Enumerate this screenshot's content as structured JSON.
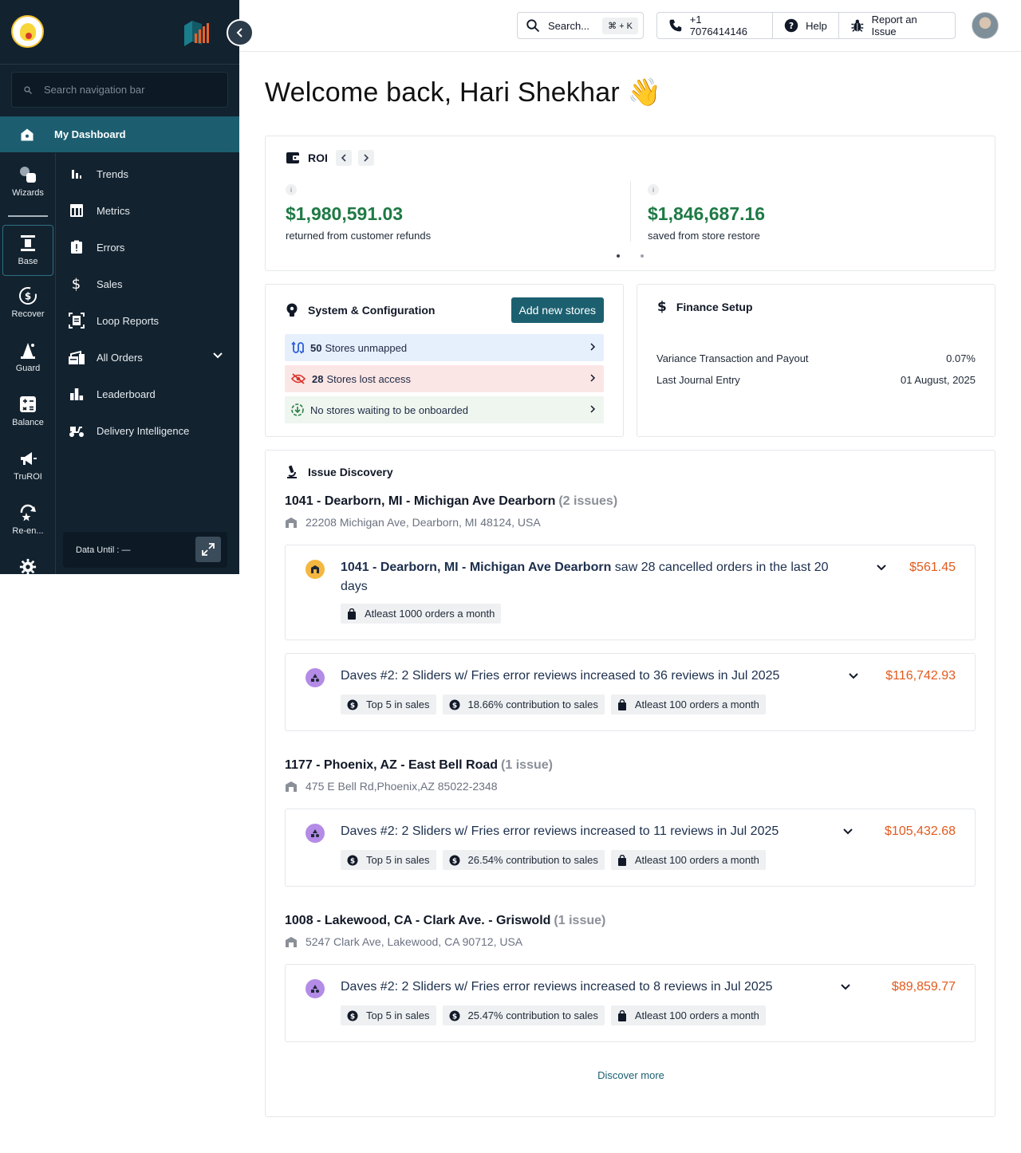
{
  "sidebar": {
    "search_placeholder": "Search navigation bar",
    "dashboard_label": "My Dashboard",
    "rail": [
      {
        "label": "Wizards"
      },
      {
        "label": "Base"
      },
      {
        "label": "Recover"
      },
      {
        "label": "Guard"
      },
      {
        "label": "Balance"
      },
      {
        "label": "TruROI"
      },
      {
        "label": "Re-en..."
      }
    ],
    "subnav": [
      {
        "label": "Trends"
      },
      {
        "label": "Metrics"
      },
      {
        "label": "Errors"
      },
      {
        "label": "Sales"
      },
      {
        "label": "Loop Reports"
      },
      {
        "label": "All Orders"
      },
      {
        "label": "Leaderboard"
      },
      {
        "label": "Delivery Intelligence"
      }
    ],
    "data_until": "Data Until : —"
  },
  "topbar": {
    "search_label": "Search...",
    "shortcut": "⌘ + K",
    "phone": "+1 7076414146",
    "help": "Help",
    "report": "Report an Issue"
  },
  "welcome": "Welcome back, Hari Shekhar 👋",
  "roi": {
    "title": "ROI",
    "info": "i",
    "items": [
      {
        "value": "$1,980,591.03",
        "caption": "returned from customer refunds"
      },
      {
        "value": "$1,846,687.16",
        "caption": "saved from store restore"
      }
    ]
  },
  "system": {
    "title": "System & Configuration",
    "add_button": "Add new stores",
    "rows": [
      {
        "count": "50",
        "text": "Stores unmapped"
      },
      {
        "count": "28",
        "text": "Stores lost access"
      },
      {
        "text": "No stores waiting to be onboarded"
      }
    ]
  },
  "finance": {
    "title": "Finance Setup",
    "rows": [
      {
        "label": "Variance Transaction and Payout",
        "value": "0.07%"
      },
      {
        "label": "Last Journal Entry",
        "value": "01 August, 2025"
      }
    ]
  },
  "issues": {
    "title": "Issue Discovery",
    "stores": [
      {
        "name": "1041 - Dearborn, MI - Michigan Ave Dearborn",
        "count": "(2 issues)",
        "address": "22208 Michigan Ave, Dearborn, MI 48124, USA",
        "items": [
          {
            "bold": "1041 - Dearborn, MI - Michigan Ave Dearborn",
            "text": " saw 28 cancelled orders in the last 20 days",
            "amount": "$561.45",
            "chips": [
              {
                "icon": "bag-icon",
                "label": "Atleast 1000 orders a month"
              }
            ]
          },
          {
            "text": "Daves #2: 2 Sliders w/ Fries error reviews increased to 36 reviews in Jul 2025",
            "amount": "$116,742.93",
            "chips": [
              {
                "icon": "dollar-icon",
                "label": "Top 5 in sales"
              },
              {
                "icon": "dollar-icon",
                "label": "18.66% contribution to sales"
              },
              {
                "icon": "bag-icon",
                "label": "Atleast 100 orders a month"
              }
            ]
          }
        ]
      },
      {
        "name": "1177 - Phoenix, AZ - East Bell Road",
        "count": "(1 issue)",
        "address": "475 E Bell Rd,Phoenix,AZ 85022-2348",
        "items": [
          {
            "text": "Daves #2: 2 Sliders w/ Fries error reviews increased to 11 reviews in Jul 2025",
            "amount": "$105,432.68",
            "chips": [
              {
                "icon": "dollar-icon",
                "label": "Top 5 in sales"
              },
              {
                "icon": "dollar-icon",
                "label": "26.54% contribution to sales"
              },
              {
                "icon": "bag-icon",
                "label": "Atleast 100 orders a month"
              }
            ]
          }
        ]
      },
      {
        "name": "1008 - Lakewood, CA - Clark Ave. - Griswold",
        "count": "(1 issue)",
        "address": "5247 Clark Ave, Lakewood, CA 90712, USA",
        "items": [
          {
            "text": "Daves #2: 2 Sliders w/ Fries error reviews increased to 8 reviews in Jul 2025",
            "amount": "$89,859.77",
            "chips": [
              {
                "icon": "dollar-icon",
                "label": "Top 5 in sales"
              },
              {
                "icon": "dollar-icon",
                "label": "25.47% contribution to sales"
              },
              {
                "icon": "bag-icon",
                "label": "Atleast 100 orders a month"
              }
            ]
          }
        ]
      }
    ],
    "discover_more": "Discover more"
  },
  "colors": {
    "sidebar_bg": "#13222f",
    "accent": "#1c6070",
    "roi_green": "#1e7a45",
    "amount_orange": "#e25a1c"
  }
}
